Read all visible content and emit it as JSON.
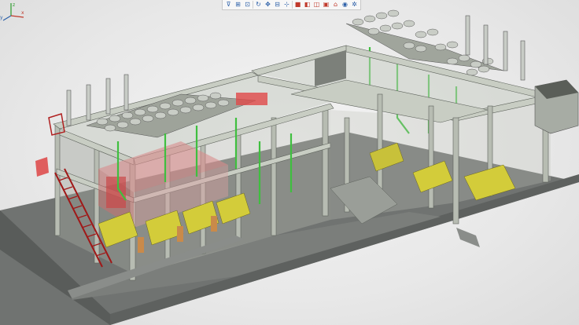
{
  "app": {
    "window": "3D plant model viewport",
    "model": "power plant building with genset halls, radiator roofs and exhaust stacks"
  },
  "colors": {
    "background": "#e6e6e6",
    "slab": "#6f7270",
    "slab_edge": "#4f524f",
    "steel": "#b8bdb4",
    "steel_dark": "#8d948b",
    "piping": "#3fbf3f",
    "engine": "#d8d23a",
    "stair": "#b02020",
    "accent_red": "#e04040"
  },
  "toolbar": {
    "buttons": [
      {
        "name": "filter-icon",
        "glyph": "⊽"
      },
      {
        "name": "fit-view-icon",
        "glyph": "⊞"
      },
      {
        "name": "zoom-box-icon",
        "glyph": "⊡"
      },
      {
        "name": "rotate-icon",
        "glyph": "↻"
      },
      {
        "name": "pan-icon",
        "glyph": "✥"
      },
      {
        "name": "section-icon",
        "glyph": "⊟"
      },
      {
        "name": "measure-icon",
        "glyph": "⊹"
      },
      {
        "name": "render-solid-icon",
        "glyph": "■"
      },
      {
        "name": "render-shaded-icon",
        "glyph": "◧"
      },
      {
        "name": "render-wire-icon",
        "glyph": "◫"
      },
      {
        "name": "render-hidden-icon",
        "glyph": "▣"
      },
      {
        "name": "house-icon",
        "glyph": "⌂"
      },
      {
        "name": "color-icon",
        "glyph": "◉"
      },
      {
        "name": "settings-icon",
        "glyph": "✲"
      }
    ]
  },
  "triad": {
    "x": "x",
    "y": "y",
    "z": "z"
  }
}
